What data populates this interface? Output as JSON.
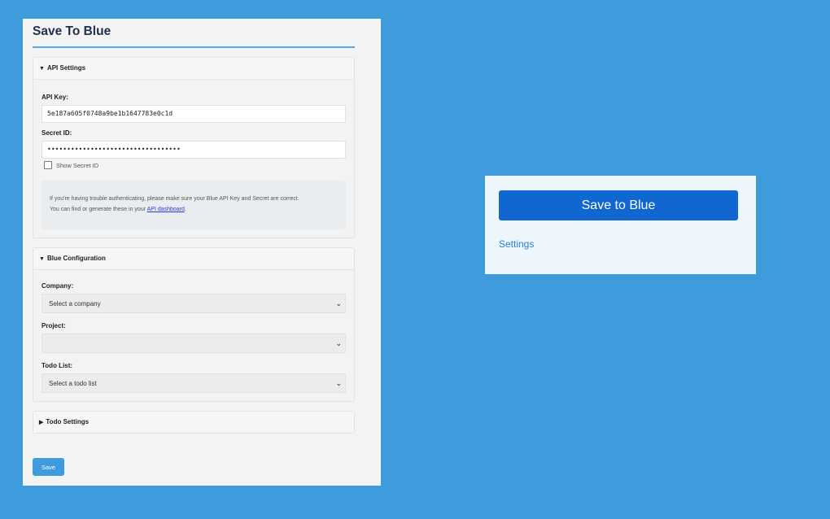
{
  "settings": {
    "title": "Save To Blue",
    "api_section": {
      "header": "API Settings",
      "api_key_label": "API Key:",
      "api_key_value": "5e187a605f0748a9be1b1647783e0c1d",
      "secret_label": "Secret ID:",
      "secret_value": "••••••••••••••••••••••••••••••••••",
      "show_secret_label": "Show Secret ID",
      "show_secret_checked": false,
      "info_text_line1": "If you're having trouble authenticating, please make sure your Blue API Key and Secret are correct.",
      "info_text_line2_prefix": "You can find or generate these in your ",
      "info_link": "API dashboard",
      "info_text_line2_suffix": "."
    },
    "config_section": {
      "header": "Blue Configuration",
      "company_label": "Company:",
      "company_value": "Select a company",
      "project_label": "Project:",
      "project_value": "",
      "todo_list_label": "Todo List:",
      "todo_list_value": "Select a todo list"
    },
    "todo_section": {
      "header": "Todo Settings"
    },
    "save_label": "Save"
  },
  "popup": {
    "button_label": "Save to Blue",
    "settings_link": "Settings"
  },
  "icons": {
    "expanded": "triangle-down",
    "collapsed": "triangle-right",
    "select": "chevron-down"
  },
  "colors": {
    "background": "#3e9bdc",
    "primary_button": "#1167d1",
    "link": "#2b7fd0"
  }
}
